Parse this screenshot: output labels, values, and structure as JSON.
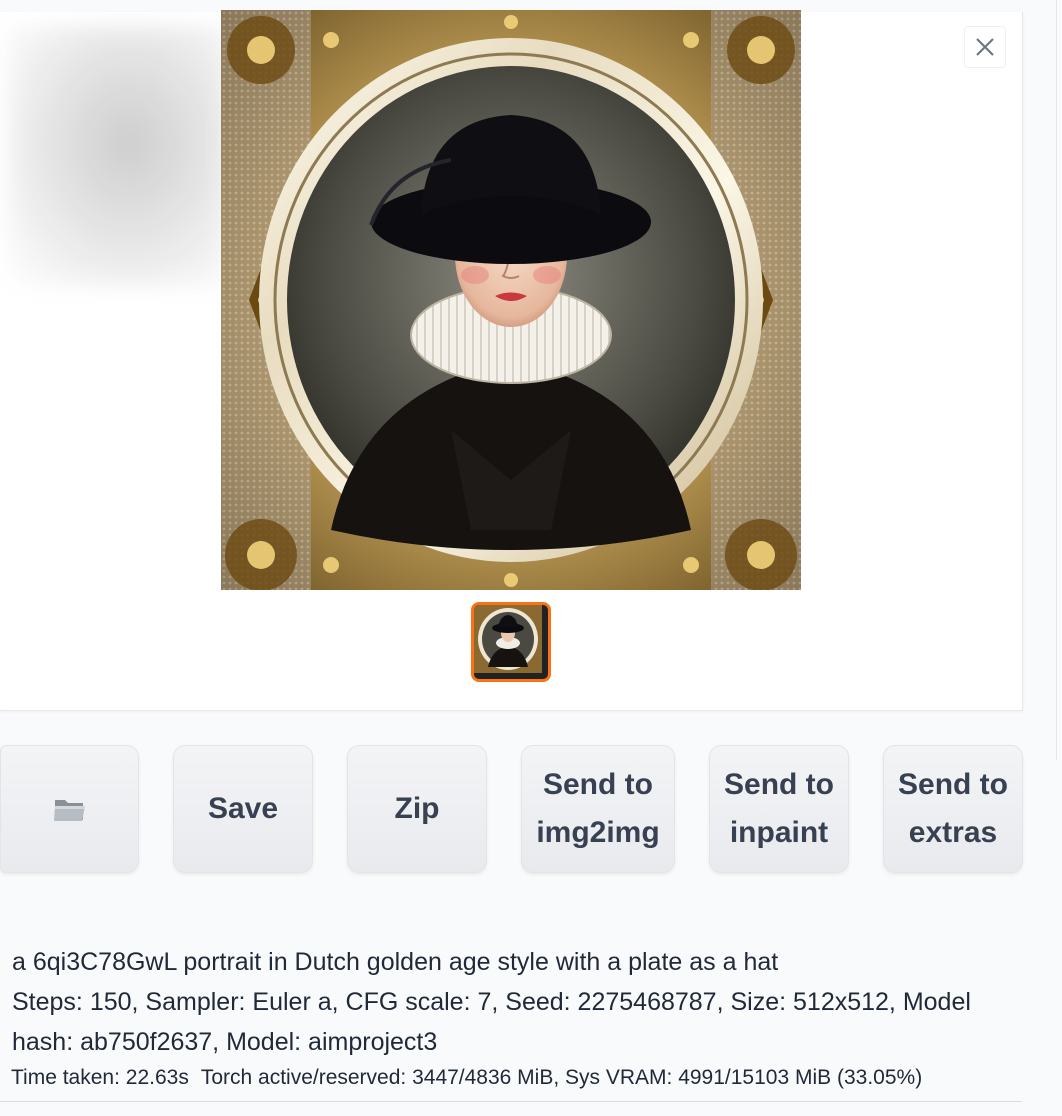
{
  "gallery": {
    "main_image_alt": "Dutch golden age portrait in an ornate oval gold frame",
    "thumbnail_alt": "portrait thumbnail",
    "close_icon": "close-icon"
  },
  "buttons": {
    "folder_icon": "folder-icon",
    "save_label": "Save",
    "zip_label": "Zip",
    "img2img_line1": "Send to",
    "img2img_line2": "img2img",
    "inpaint_line1": "Send to",
    "inpaint_line2": "inpaint",
    "extras_line1": "Send to",
    "extras_line2": "extras"
  },
  "generation_info": {
    "prompt": "a 6qi3C78GwL portrait in Dutch golden age style with a plate as a hat",
    "params_line1": "Steps: 150, Sampler: Euler a, CFG scale: 7, Seed: 2275468787, Size: 512x512, Model",
    "params_line2": "hash: ab750f2637, Model: aimproject3"
  },
  "performance": {
    "time_taken": "Time taken: 22.63s",
    "memory": "Torch active/reserved: 3447/4836 MiB, Sys VRAM: 4991/15103 MiB (33.05%)"
  },
  "colors": {
    "selected_thumb_border": "#f97316",
    "button_text": "#374151"
  }
}
